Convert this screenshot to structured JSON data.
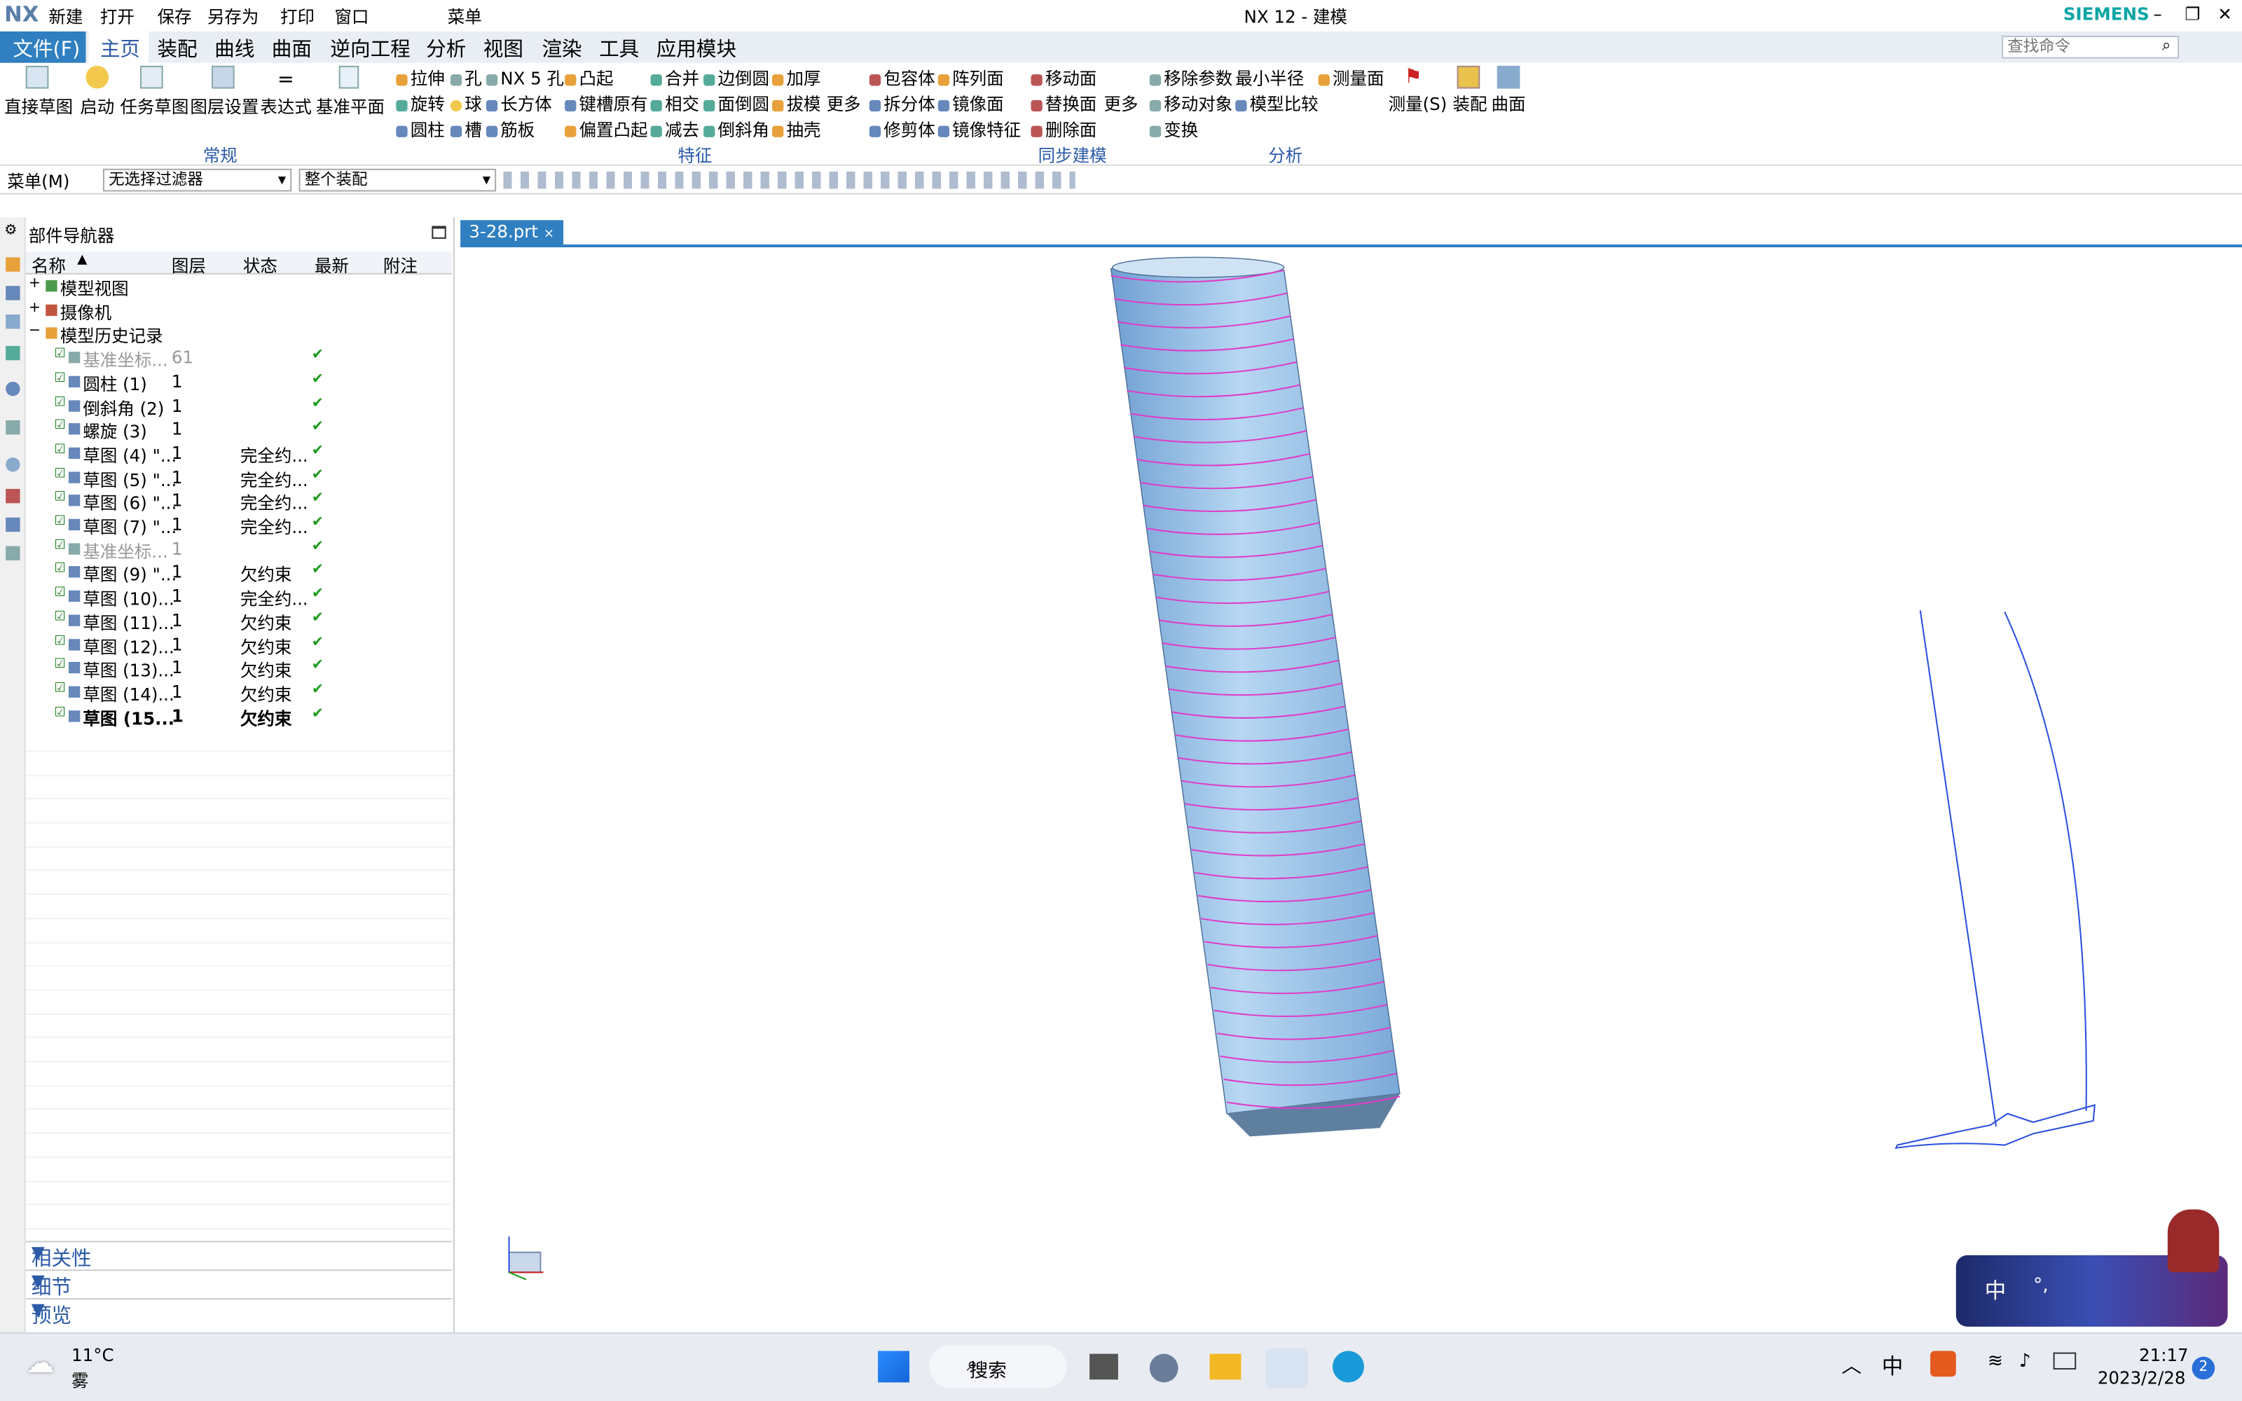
{
  "title": {
    "logo": "NX",
    "new": "新建",
    "open": "打开",
    "save": "保存",
    "save_as": "另存为",
    "print": "打印",
    "window": "窗口",
    "menu": "菜单",
    "app_title": "NX 12 - 建模",
    "brand": "SIEMENS"
  },
  "menubar": {
    "file": "文件(F)",
    "tabs": [
      "主页",
      "装配",
      "曲线",
      "曲面",
      "逆向工程",
      "分析",
      "视图",
      "渲染",
      "工具",
      "应用模块"
    ],
    "search_placeholder": "查找命令"
  },
  "ribbon": {
    "big": [
      "直接草图",
      "启动",
      "任务草图",
      "图层设置",
      "表达式",
      "基准平面"
    ],
    "feat": [
      "拉伸",
      "孔",
      "NX 5 孔",
      "凸起",
      "合并",
      "边倒圆",
      "加厚",
      "包容体",
      "阵列面",
      "旋转",
      "球",
      "长方体",
      "键槽原有",
      "相交",
      "面倒圆",
      "拔模",
      "拆分体",
      "镜像面",
      "圆柱",
      "槽",
      "筋板",
      "偏置凸起",
      "减去",
      "倒斜角",
      "抽壳",
      "修剪体",
      "镜像特征",
      "更多"
    ],
    "sync": [
      "移动面",
      "替换面",
      "删除面",
      "更多"
    ],
    "ana": [
      "移除参数",
      "最小半径",
      "测量面",
      "移动对象",
      "模型比较",
      "变换",
      "测量(S)",
      "装配",
      "曲面"
    ],
    "groups": [
      "常规",
      "特征",
      "同步建模",
      "分析"
    ]
  },
  "toolbar": {
    "menu": "菜单(M)",
    "filter": "无选择过滤器",
    "assembly": "整个装配"
  },
  "navigator": {
    "title": "部件导航器",
    "columns": [
      "名称",
      "图层",
      "状态",
      "最新",
      "附注"
    ],
    "rows": [
      {
        "name": "模型视图",
        "layer": "",
        "status": "",
        "latest": ""
      },
      {
        "name": "摄像机",
        "layer": "",
        "status": "",
        "latest": ""
      },
      {
        "name": "模型历史记录",
        "layer": "",
        "status": "",
        "latest": ""
      },
      {
        "name": "基准坐标...",
        "layer": "61",
        "status": "",
        "latest": "✔"
      },
      {
        "name": "圆柱 (1)",
        "layer": "1",
        "status": "",
        "latest": "✔"
      },
      {
        "name": "倒斜角 (2)",
        "layer": "1",
        "status": "",
        "latest": "✔"
      },
      {
        "name": "螺旋 (3)",
        "layer": "1",
        "status": "",
        "latest": "✔"
      },
      {
        "name": "草图 (4) \"...",
        "layer": "1",
        "status": "完全约...",
        "latest": "✔"
      },
      {
        "name": "草图 (5) \"...",
        "layer": "1",
        "status": "完全约...",
        "latest": "✔"
      },
      {
        "name": "草图 (6) \"...",
        "layer": "1",
        "status": "完全约...",
        "latest": "✔"
      },
      {
        "name": "草图 (7) \"...",
        "layer": "1",
        "status": "完全约...",
        "latest": "✔"
      },
      {
        "name": "基准坐标...",
        "layer": "1",
        "status": "",
        "latest": "✔"
      },
      {
        "name": "草图 (9) \"...",
        "layer": "1",
        "status": "欠约束",
        "latest": "✔"
      },
      {
        "name": "草图 (10)...",
        "layer": "1",
        "status": "完全约...",
        "latest": "✔"
      },
      {
        "name": "草图 (11)...",
        "layer": "1",
        "status": "欠约束",
        "latest": "✔"
      },
      {
        "name": "草图 (12)...",
        "layer": "1",
        "status": "欠约束",
        "latest": "✔"
      },
      {
        "name": "草图 (13)...",
        "layer": "1",
        "status": "欠约束",
        "latest": "✔"
      },
      {
        "name": "草图 (14)...",
        "layer": "1",
        "status": "欠约束",
        "latest": "✔"
      },
      {
        "name": "草图 (15...",
        "layer": "1",
        "status": "欠约束",
        "latest": "✔"
      }
    ],
    "panels": [
      "相关性",
      "细节",
      "预览"
    ]
  },
  "viewport": {
    "tab": "3-28.prt"
  },
  "taskbar": {
    "temp": "11°C",
    "weather": "雾",
    "search": "搜索",
    "ime": "中",
    "time": "21:17",
    "date": "2023/2/28",
    "notif": "2",
    "ime_widget": "中"
  }
}
